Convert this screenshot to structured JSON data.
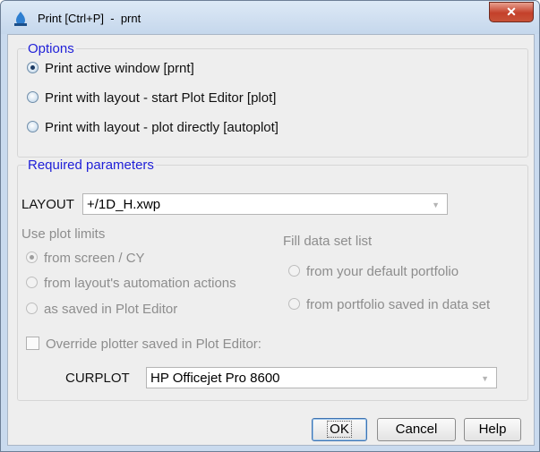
{
  "window": {
    "title": "Print [Ctrl+P]  -  prnt",
    "close_label": "✕"
  },
  "options": {
    "legend": "Options",
    "items": [
      {
        "label": "Print active window [prnt]",
        "checked": true
      },
      {
        "label": "Print with layout - start Plot Editor [plot]",
        "checked": false
      },
      {
        "label": "Print with layout - plot directly [autoplot]",
        "checked": false
      }
    ]
  },
  "required": {
    "legend": "Required parameters",
    "layout_label": "LAYOUT",
    "layout_value": "+/1D_H.xwp",
    "plot_limits": {
      "label": "Use plot limits",
      "items": [
        {
          "label": "from screen / CY",
          "checked": true
        },
        {
          "label": "from layout's automation actions",
          "checked": false
        },
        {
          "label": "as saved in Plot Editor",
          "checked": false
        }
      ]
    },
    "fill_list": {
      "label": "Fill data set list",
      "items": [
        {
          "label": "from your default portfolio",
          "checked": false
        },
        {
          "label": "from portfolio saved in data set",
          "checked": false
        }
      ]
    },
    "override_label": "Override plotter saved in Plot Editor:",
    "curplot_label": "CURPLOT",
    "curplot_value": "HP Officejet Pro 8600"
  },
  "buttons": {
    "ok": "OK",
    "cancel": "Cancel",
    "help": "Help"
  },
  "colors": {
    "legend": "#1f1fd8",
    "title_bar": "#c9daee",
    "close": "#c4402a"
  }
}
